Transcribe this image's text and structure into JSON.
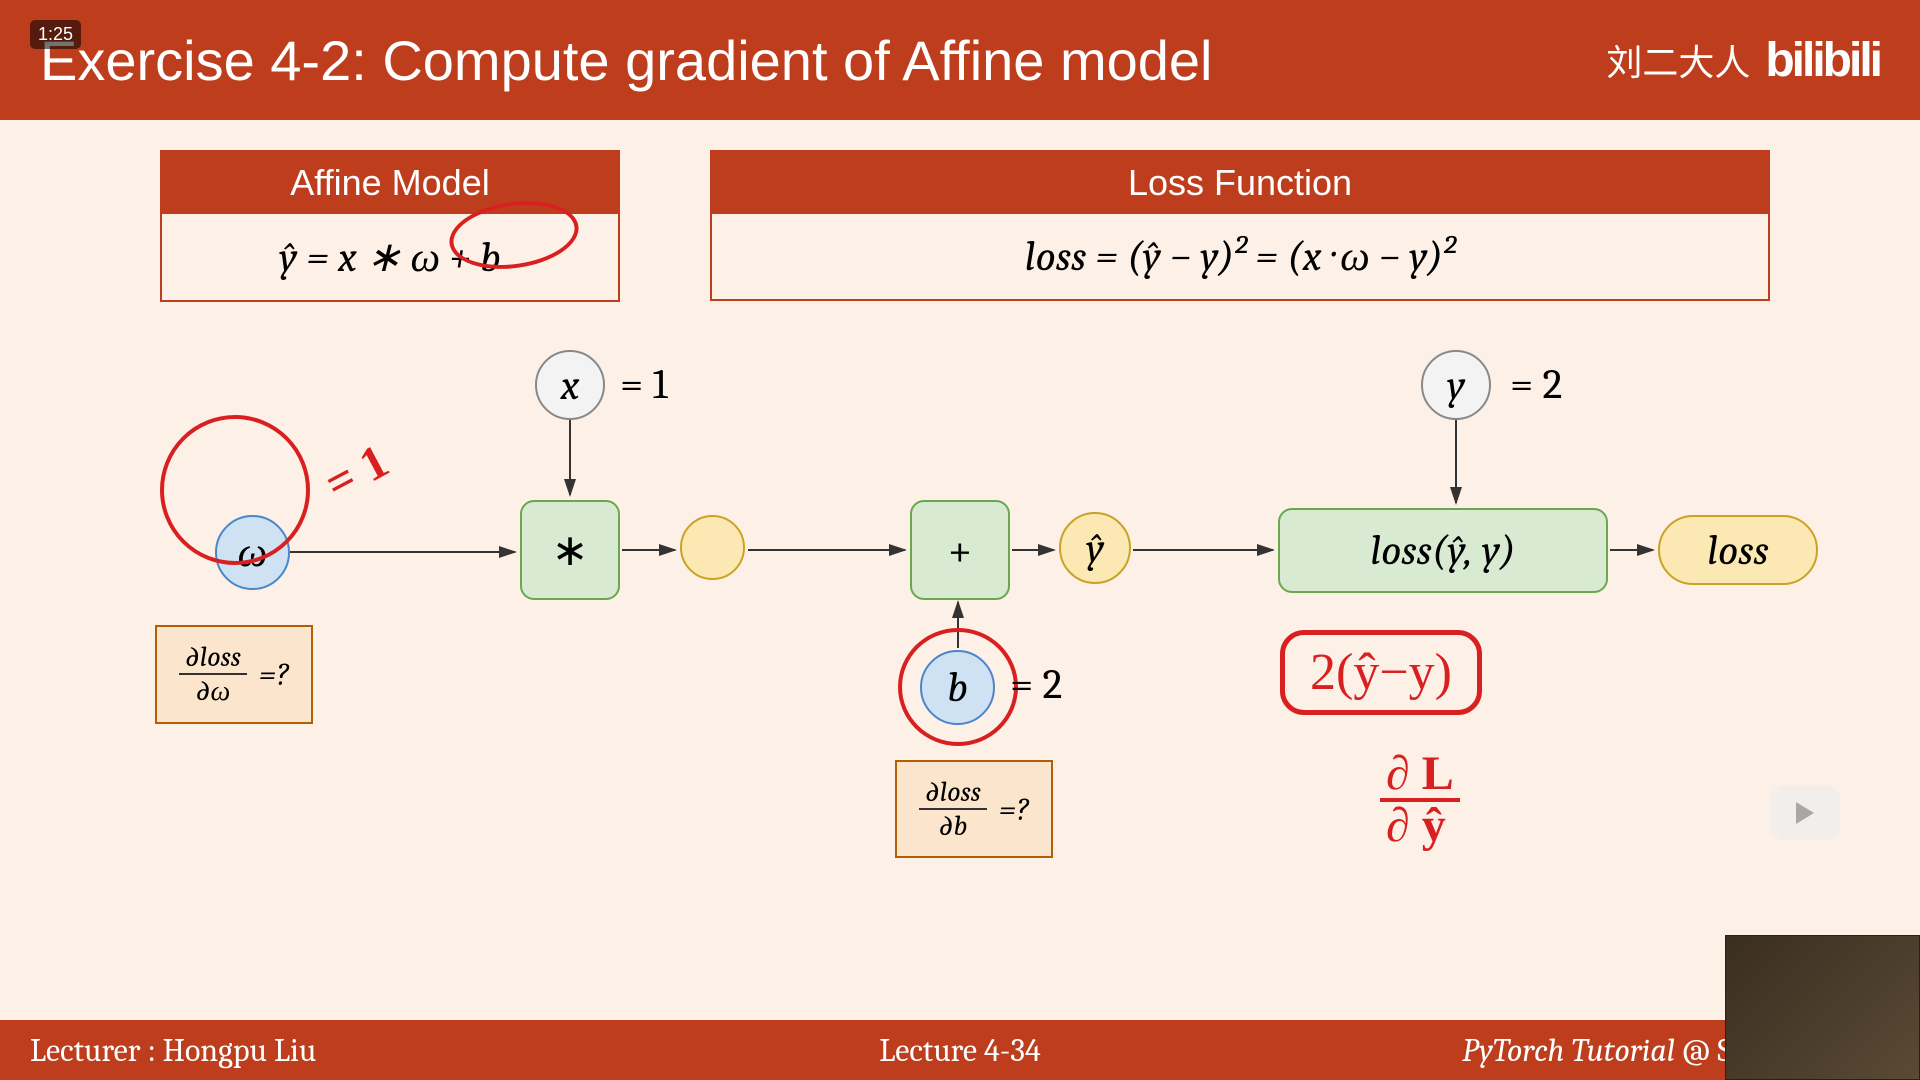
{
  "header": {
    "title": "Exercise 4-2: Compute gradient of Affine model",
    "author": "刘二大人",
    "logo": "bilibili"
  },
  "badge": "1:25",
  "formulas": {
    "affine": {
      "title": "Affine Model",
      "equation": "ŷ = x ∗ ω + b"
    },
    "loss": {
      "title": "Loss Function",
      "equation": "loss = (ŷ − y)² = (x · ω − y)²"
    }
  },
  "nodes": {
    "omega": "ω",
    "x": "x",
    "b": "b",
    "y": "y",
    "yhat": "ŷ",
    "mult": "∗",
    "plus": "+",
    "lossfn": "loss(ŷ, y)",
    "lossout": "loss"
  },
  "values": {
    "x": "= 1",
    "y": "= 2",
    "omega": "= 1",
    "b": "= 2"
  },
  "gradients": {
    "w_num": "∂loss",
    "w_den": "∂ω",
    "w_eq": "=?",
    "b_num": "∂loss",
    "b_den": "∂b",
    "b_eq": "=?"
  },
  "annotations": {
    "deriv": "2(ŷ−y)",
    "frac_top": "∂ L",
    "frac_bot": "∂ ŷ"
  },
  "footer": {
    "left": "Lecturer : Hongpu Liu",
    "center": "Lecture 4-34",
    "right_italic": "PyTorch Tutorial",
    "right_rest": " @ SLAM Resear"
  }
}
